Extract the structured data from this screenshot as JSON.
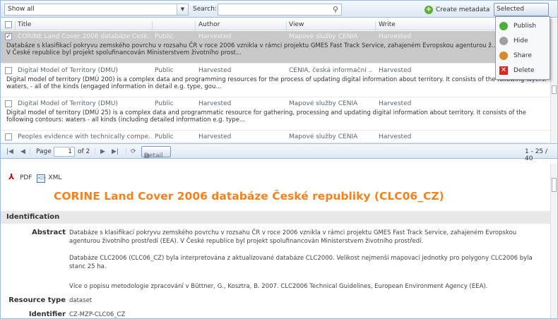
{
  "toolbar": {
    "filter_value": "Show all",
    "search_label": "Search:",
    "search_value": "",
    "create_label": "Create metadata",
    "selected_label": "Selected records"
  },
  "grid": {
    "headers": [
      "Title",
      "Author",
      "View",
      "Write"
    ],
    "rows": [
      {
        "checked": "✓",
        "title": "CORINE Land Cover 2006 databáze Česk...",
        "access": "Public",
        "author": "Harvested",
        "view": "Mapové služby CENIA",
        "write": "Harvested",
        "desc": "Databáze s klasifikací pokryvu zemského povrchu v rozsahu ČR v roce 2006 vznikla v rámci projektu GMES Fast Track Service, zahajeném Evropskou agenturou ž... prostředí (EEA). V České republice byl projekt spolufinancován Ministerstvem životního prost..."
      },
      {
        "checked": "",
        "title": "Digital Model of Territory (DMÚ)",
        "access": "Public",
        "author": "Harvested",
        "view": "CENIA, česká informační ...",
        "write": "Harvested",
        "desc": "Digital model of territory (DMÚ 200) is a complex data and programming resources for the process of updating digital information about territory. It consists of the following layers: waters, - all of the kinds (engaged information in detail e.g. type, gou..."
      },
      {
        "checked": "",
        "title": "Digital Model of Territory (DMÚ)",
        "access": "Public",
        "author": "Harvested",
        "view": "Mapové služby CENIA",
        "write": "Harvested",
        "desc": "Digital model of territory (DMÚ 25) is a complex data and programmatic resource for gathering, processing and updating digital information about territory. It consists of the following contours: waters - all kinds (including detailed information e.g. type..."
      },
      {
        "checked": "",
        "title": "Peoples evidence with technically compe...",
        "access": "Public",
        "author": "Harvested",
        "view": "Mapové služby CENIA",
        "write": "Harvested",
        "desc": ""
      }
    ]
  },
  "paging": {
    "page_label": "Page",
    "page_value": "1",
    "of_label": "of 2",
    "detail_label": "Detail",
    "range": "1 - 25 / 40"
  },
  "menu": [
    {
      "label": "Publish",
      "color": "#4caf3a"
    },
    {
      "label": "Hide",
      "color": "#a0a0a0"
    },
    {
      "label": "Share",
      "color": "#d58a2c"
    },
    {
      "label": "Delete",
      "color": "#d9271f"
    }
  ],
  "detail": {
    "pdf_label": "PDF",
    "xml_label": "XML",
    "title": "CORINE Land Cover 2006 databáze České republiky (CLC06_CZ)",
    "section": "Identification",
    "abstract_label": "Abstract",
    "abstract_p1": "Databáze s klasifikací pokryvu zemského povrchu v rozsahu ČR v roce 2006 vznikla v rámci projektu GMES Fast Track Service, zahajeném Evropskou agenturou životního prostředí (EEA). V České republice byl projekt spolufinancován Ministerstvem životního prostředí.",
    "abstract_p2": "Databáze CLC2006 (CLC06_CZ) byla interpretována z aktualizované databáze CLC2000. Velikost nejmenší mapovací jednotky pro polygony CLC2006 byla stanc 25 ha.",
    "abstract_p3": "Více o popisu metodologie zpracování v Büttner, G., Kosztra, B. 2007. CLC2006 Technical Guidelines, European Environment Agency (EEA).",
    "resource_label": "Resource type",
    "resource_value": "dataset",
    "identifier_label": "Identifier",
    "identifier_value": "CZ-MZP-CLC06_CZ"
  }
}
